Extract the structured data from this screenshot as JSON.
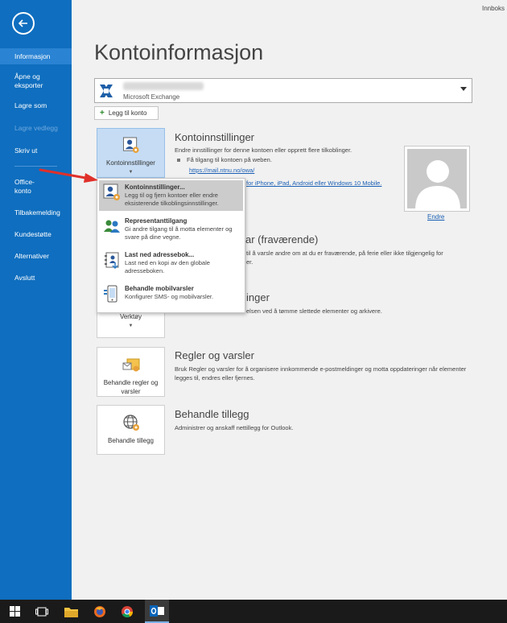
{
  "window": {
    "title_right": "Innboks"
  },
  "sidebar": {
    "items": [
      {
        "label": "Informasjon",
        "active": true
      },
      {
        "label": "Åpne og eksporter"
      },
      {
        "label": "Lagre som"
      },
      {
        "label": "Lagre vedlegg",
        "disabled": true
      },
      {
        "label": "Skriv ut"
      },
      {
        "label": "Office-konto"
      },
      {
        "label": "Tilbakemelding"
      },
      {
        "label": "Kundestøtte"
      },
      {
        "label": "Alternativer"
      },
      {
        "label": "Avslutt"
      }
    ]
  },
  "main": {
    "title": "Kontoinformasjon",
    "account": {
      "type": "Microsoft Exchange"
    },
    "add_account": "Legg til konto",
    "sections": {
      "account_settings": {
        "tile_label": "Kontoinnstillinger",
        "title": "Kontoinnstillinger",
        "desc": "Endre innstillinger for denne kontoen eller opprett flere tilkoblinger.",
        "bullet": "Få tilgang til kontoen på weben.",
        "web_link": "https://mail.ntnu.no/owa/",
        "mobile_link": "for iPhone, iPad, Android eller Windows 10 Mobile."
      },
      "auto_reply": {
        "title_fragment": "ar (fraværende)",
        "desc_1": "til å varsle andre om at du er fraværende, på ferie eller ikke tilgjengelig for",
        "desc_2": "er."
      },
      "cleanup": {
        "tile_label": "Verktøy",
        "title_fragment": "inger",
        "desc": "elsen ved å tømme slettede elementer og arkivere."
      },
      "rules": {
        "tile_label": "Behandle regler og varsler",
        "title": "Regler og varsler",
        "desc": "Bruk Regler og varsler for å organisere innkommende e-postmeldinger og motta oppdateringer når elementer legges til, endres eller fjernes."
      },
      "addins": {
        "tile_label": "Behandle tillegg",
        "title": "Behandle tillegg",
        "desc": "Administrer og anskaff nettillegg for Outlook."
      }
    },
    "profile": {
      "change_label": "Endre"
    }
  },
  "menu": {
    "items": [
      {
        "title": "Kontoinnstillinger...",
        "desc": "Legg til og fjern kontoer eller endre eksisterende tilkoblingsinnstillinger.",
        "icon": "account-settings-icon"
      },
      {
        "title": "Representanttilgang",
        "desc": "Gi andre tilgang til å motta elementer og svare på dine vegne.",
        "icon": "delegate-icon"
      },
      {
        "title": "Last ned adressebok...",
        "desc": "Last ned en kopi av den globale adresseboken.",
        "icon": "address-book-icon"
      },
      {
        "title": "Behandle mobilvarsler",
        "desc": "Konfigurer SMS- og mobilvarsler.",
        "icon": "mobile-alerts-icon"
      }
    ]
  },
  "taskbar": {
    "items": [
      "windows-start-icon",
      "task-view-icon",
      "file-explorer-icon",
      "firefox-icon",
      "chrome-icon",
      "outlook-icon"
    ]
  },
  "colors": {
    "sidebar": "#0f6ebf",
    "link": "#1a5fb4",
    "arrow": "#e0302a"
  }
}
